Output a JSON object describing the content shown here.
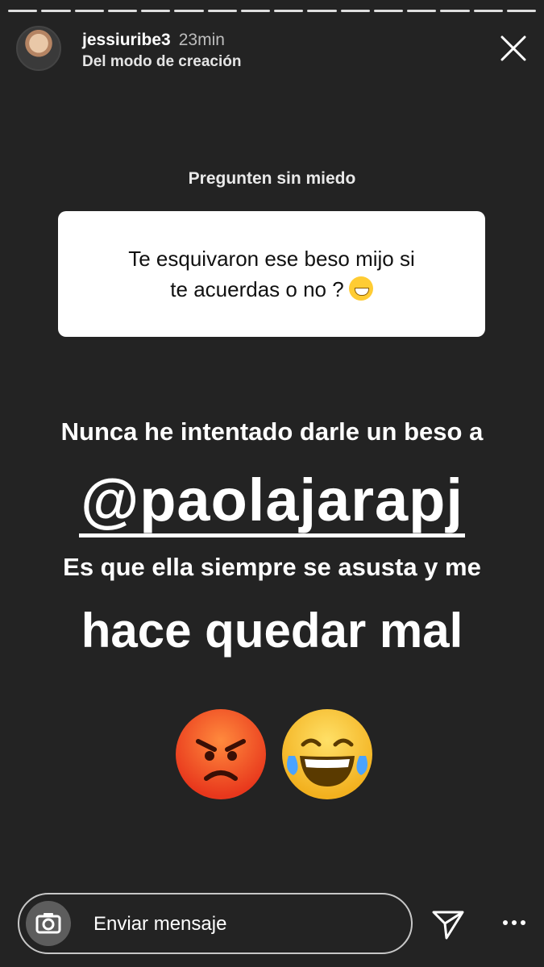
{
  "header": {
    "username": "jessiuribe3",
    "time": "23min",
    "subtitle": "Del modo de creación"
  },
  "qa": {
    "title": "Pregunten sin miedo",
    "question_line1": "Te esquivaron ese beso mijo si",
    "question_line2": "te acuerdas o no ?"
  },
  "story": {
    "line1": "Nunca he intentado darle un beso a",
    "mention": "@paolajarapj",
    "line2": "Es que ella siempre se asusta y me",
    "line3": "hace quedar mal"
  },
  "footer": {
    "message_placeholder": "Enviar mensaje"
  },
  "icons": {
    "close": "close-icon",
    "camera": "camera-icon",
    "send": "send-icon",
    "more": "more-icon"
  }
}
